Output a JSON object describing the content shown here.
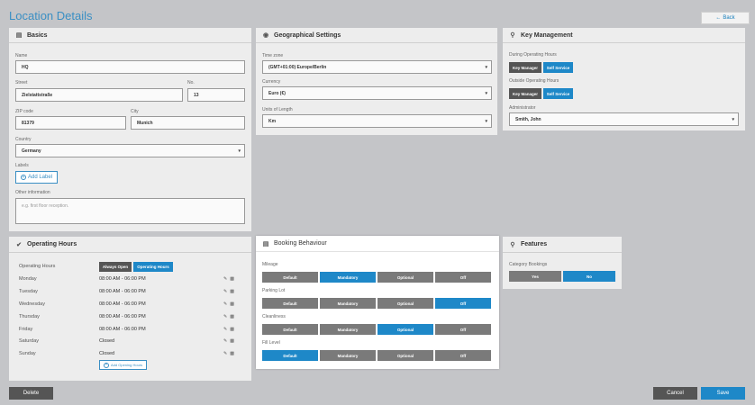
{
  "page": {
    "title": "Location Details",
    "back_label": "Back"
  },
  "basics": {
    "title": "Basics",
    "name_label": "Name",
    "name_value": "HQ",
    "street_label": "Street",
    "street_value": "Zielstattstraße",
    "no_label": "No.",
    "no_value": "13",
    "zip_label": "ZIP code",
    "zip_value": "81379",
    "city_label": "City",
    "city_value": "Munich",
    "country_label": "Country",
    "country_value": "Germany",
    "labels_label": "Labels",
    "add_label": "Add Label",
    "other_label": "Other information",
    "other_placeholder": "e.g. first floor reception."
  },
  "geo": {
    "title": "Geographical Settings",
    "timezone_label": "Time zone",
    "timezone_value": "(GMT+01:00) Europe/Berlin",
    "currency_label": "Currency",
    "currency_value": "Euro (€)",
    "units_label": "Units of Length",
    "units_value": "Km"
  },
  "keys": {
    "title": "Key Management",
    "during_label": "During Operating Hours",
    "outside_label": "Outside Operating Hours",
    "opt_manager": "Key Manager",
    "opt_self": "Self Service",
    "admin_label": "Administrator",
    "admin_value": "Smith, John"
  },
  "hours": {
    "title": "Operating Hours",
    "mode_label": "Operating Hours",
    "always_open": "Always Open",
    "operating_hours": "Operating Hours",
    "days": [
      {
        "day": "Monday",
        "time": "08:00 AM - 06:00 PM"
      },
      {
        "day": "Tuesday",
        "time": "08:00 AM - 06:00 PM"
      },
      {
        "day": "Wednesday",
        "time": "08:00 AM - 06:00 PM"
      },
      {
        "day": "Thursday",
        "time": "08:00 AM - 06:00 PM"
      },
      {
        "day": "Friday",
        "time": "08:00 AM - 06:00 PM"
      },
      {
        "day": "Saturday",
        "time": "Closed"
      },
      {
        "day": "Sunday",
        "time": "Closed"
      }
    ],
    "add_label": "Add Opening Hours"
  },
  "booking": {
    "title": "Booking Behaviour",
    "options": [
      "Default",
      "Mandatory",
      "Optional",
      "Off"
    ],
    "rows": [
      {
        "label": "Mileage",
        "selected": "Mandatory"
      },
      {
        "label": "Parking Lot",
        "selected": "Off"
      },
      {
        "label": "Cleanliness",
        "selected": "Optional"
      },
      {
        "label": "Fill Level",
        "selected": "Default"
      }
    ]
  },
  "features": {
    "title": "Features",
    "category_label": "Category Bookings",
    "yes": "Yes",
    "no": "No",
    "selected": "No"
  },
  "actions": {
    "delete": "Delete",
    "cancel": "Cancel",
    "save": "Save"
  },
  "colors": {
    "accent": "#1e88c8",
    "gray_btn": "#7a7a7a",
    "dark_btn": "#555555"
  }
}
